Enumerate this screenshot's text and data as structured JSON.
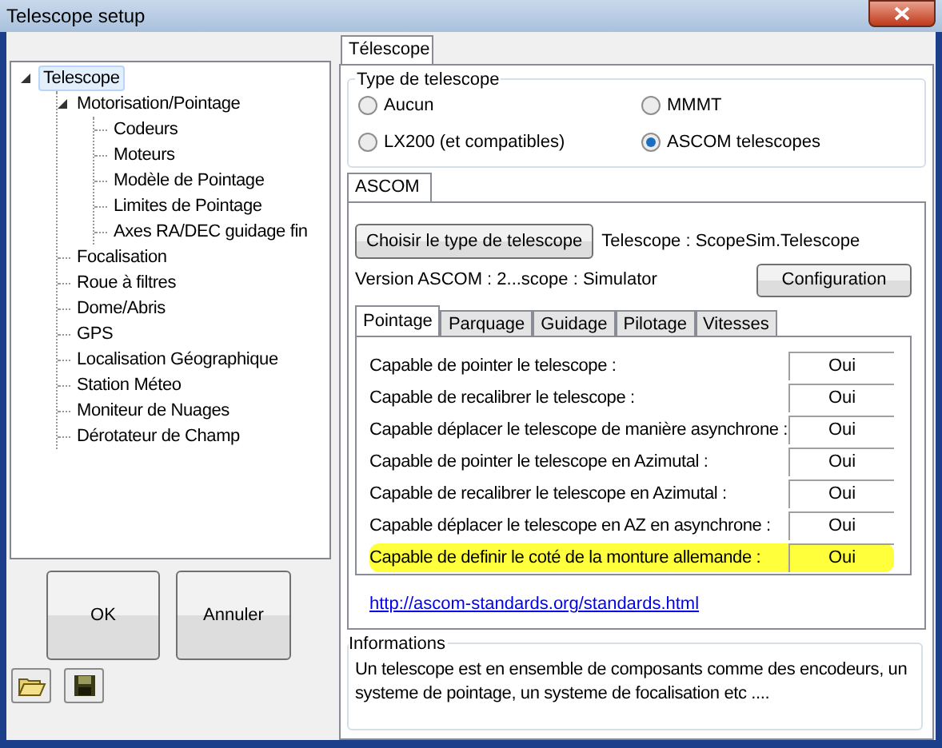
{
  "window": {
    "title": "Telescope setup"
  },
  "tree": [
    {
      "label": "Telescope",
      "selected": true,
      "expanded": true,
      "children": [
        {
          "label": "Motorisation/Pointage",
          "selected": false,
          "expanded": true,
          "children": [
            {
              "label": "Codeurs",
              "selected": false
            },
            {
              "label": "Moteurs",
              "selected": false
            },
            {
              "label": "Modèle de Pointage",
              "selected": false
            },
            {
              "label": "Limites de Pointage",
              "selected": false
            },
            {
              "label": "Axes RA/DEC guidage fin",
              "selected": false
            }
          ]
        },
        {
          "label": "Focalisation",
          "selected": false
        },
        {
          "label": "Roue à filtres",
          "selected": false
        },
        {
          "label": "Dome/Abris",
          "selected": false
        },
        {
          "label": "GPS",
          "selected": false
        },
        {
          "label": "Localisation Géographique",
          "selected": false
        },
        {
          "label": "Station Méteo",
          "selected": false
        },
        {
          "label": "Moniteur de Nuages",
          "selected": false
        },
        {
          "label": "Dérotateur de Champ",
          "selected": false
        }
      ]
    }
  ],
  "buttons": [
    "OK",
    "Annuler"
  ],
  "main_tabs": [
    {
      "label": "Télescope",
      "selected": true
    }
  ],
  "type_group": {
    "title": "Type de telescope",
    "options": [
      {
        "label": "Aucun",
        "selected": false
      },
      {
        "label": "MMMT",
        "selected": false
      },
      {
        "label": "LX200 (et compatibles)",
        "selected": false
      },
      {
        "label": "ASCOM telescopes",
        "selected": true
      }
    ]
  },
  "ascom_tabs": [
    {
      "label": "ASCOM",
      "selected": true
    }
  ],
  "choose_button": "Choisir le type de telescope",
  "telescope_label": "Telescope : ScopeSim.Telescope",
  "version_label": "Version ASCOM : 2...scope : Simulator",
  "config_button": "Configuration",
  "sub_tabs": [
    {
      "label": "Pointage",
      "selected": true
    },
    {
      "label": "Parquage",
      "selected": false
    },
    {
      "label": "Guidage",
      "selected": false
    },
    {
      "label": "Pilotage",
      "selected": false
    },
    {
      "label": "Vitesses",
      "selected": false
    }
  ],
  "capabilities": [
    {
      "label": "Capable de pointer le telescope :",
      "value": "Oui",
      "highlighted": false
    },
    {
      "label": "Capable de recalibrer le telescope :",
      "value": "Oui",
      "highlighted": false
    },
    {
      "label": "Capable déplacer le telescope de manière asynchrone :",
      "value": "Oui",
      "highlighted": false
    },
    {
      "label": "Capable de pointer le telescope en Azimutal :",
      "value": "Oui",
      "highlighted": false
    },
    {
      "label": "Capable de recalibrer le telescope en Azimutal :",
      "value": "Oui",
      "highlighted": false
    },
    {
      "label": "Capable déplacer le telescope en AZ en asynchrone :",
      "value": "Oui",
      "highlighted": false
    },
    {
      "label": "Capable de definir le coté de la monture allemande :",
      "value": "Oui",
      "highlighted": true
    }
  ],
  "link": "http://ascom-standards.org/standards.html",
  "info_group": {
    "title": "Informations",
    "text": "Un telescope est en ensemble de composants comme des encodeurs, un systeme de pointage, un systeme de focalisation etc ...."
  }
}
